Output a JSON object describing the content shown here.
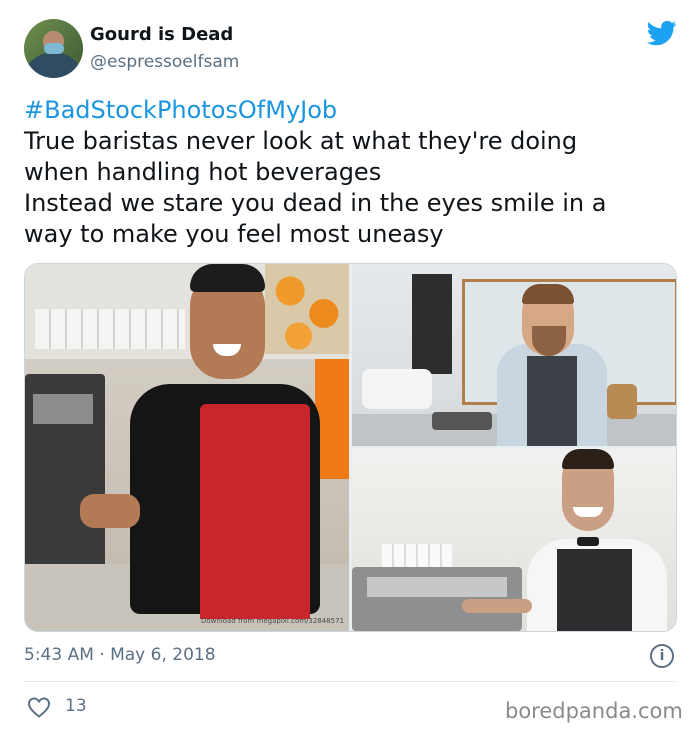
{
  "author": {
    "display_name": "Gourd is Dead",
    "handle": "@espressoelfsam"
  },
  "tweet": {
    "hashtag": "#BadStockPhotosOfMyJob",
    "lines": [
      "True baristas never look at what they're doing",
      "when handling hot beverages",
      "Instead we stare you dead in the eyes smile in a",
      "way to make you feel most uneasy"
    ]
  },
  "media": {
    "watermark": "Download from megapixl.com/32848571"
  },
  "meta": {
    "timestamp": "5:43 AM · May 6, 2018",
    "info_symbol": "i",
    "likes": "13"
  },
  "footer": {
    "credit": "boredpanda.com"
  },
  "colors": {
    "link": "#1b95e0",
    "twitter_blue": "#1da1f2",
    "apron_red": "#c8252d",
    "muted": "#5b7083"
  },
  "icons": {
    "brand": "twitter-bird-icon",
    "info": "info-circle-icon",
    "like": "heart-outline-icon"
  }
}
